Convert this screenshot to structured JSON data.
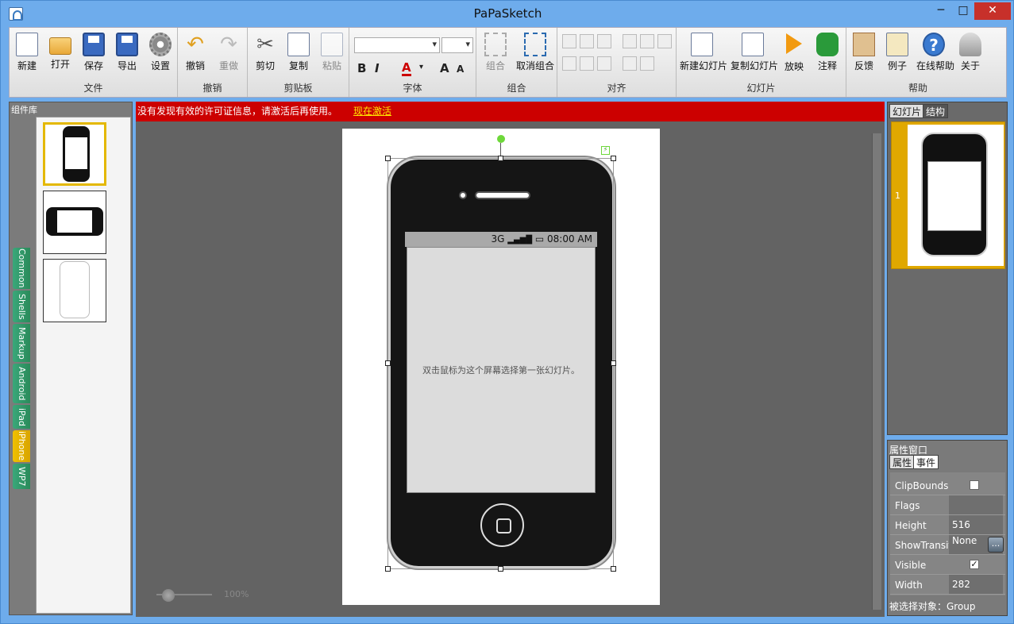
{
  "window": {
    "title": "PaPaSketch",
    "min": "─",
    "max": "□",
    "close": "✕"
  },
  "ribbon": {
    "file": {
      "label": "文件",
      "new": "新建",
      "open": "打开",
      "save": "保存",
      "export": "导出",
      "settings": "设置"
    },
    "undo": {
      "label": "撤销",
      "undo": "撤销",
      "redo": "重做"
    },
    "clipboard": {
      "label": "剪贴板",
      "cut": "剪切",
      "copy": "复制",
      "paste": "粘贴"
    },
    "font": {
      "label": "字体",
      "bold": "B",
      "italic": "I",
      "color": "A",
      "grow": "A",
      "shrink": "A"
    },
    "group": {
      "label": "组合",
      "group": "组合",
      "ungroup": "取消组合"
    },
    "align": {
      "label": "对齐"
    },
    "slides": {
      "label": "幻灯片",
      "new": "新建幻灯片",
      "copy": "复制幻灯片",
      "play": "放映",
      "note": "注释"
    },
    "help": {
      "label": "帮助",
      "feedback": "反馈",
      "example": "例子",
      "online": "在线帮助",
      "about": "关于"
    }
  },
  "library": {
    "title": "组件库",
    "tabs": [
      "Common",
      "Shells",
      "Markup",
      "Android",
      "iPad",
      "iPhone",
      "WP7"
    ],
    "active_tab": "iPhone"
  },
  "banner": {
    "message": "没有发现有效的许可证信息，请激活后再使用。",
    "link": "现在激活"
  },
  "phone": {
    "network": "3G",
    "time": "08:00 AM",
    "screen_text": "双击鼠标为这个屏幕选择第一张幻灯片。"
  },
  "zoom": {
    "value": "100%",
    "level": 0.1
  },
  "slides_panel": {
    "tab_slides": "幻灯片",
    "tab_structure": "结构",
    "slide_number": "1"
  },
  "properties": {
    "title": "属性窗口",
    "tab_props": "属性",
    "tab_events": "事件",
    "rows": [
      {
        "key": "ClipBounds",
        "value": ""
      },
      {
        "key": "Flags",
        "value": ""
      },
      {
        "key": "Height",
        "value": "516"
      },
      {
        "key": "ShowTransit",
        "value": "None"
      },
      {
        "key": "Visible",
        "value": "✓"
      },
      {
        "key": "Width",
        "value": "282"
      }
    ],
    "status": "被选择对象：Group"
  }
}
